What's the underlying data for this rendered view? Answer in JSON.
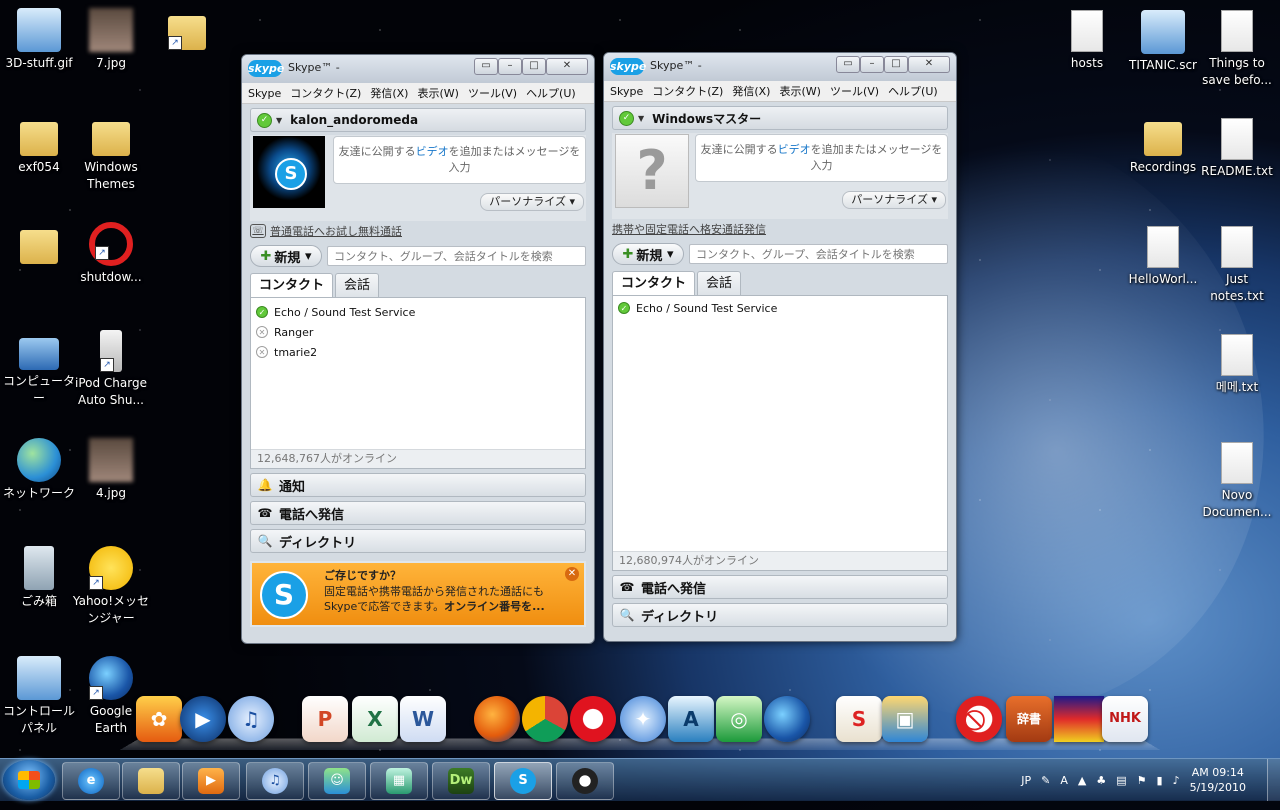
{
  "desktop": {
    "icons_left": [
      {
        "label": "3D-stuff.gif",
        "icon": "image-file-icon"
      },
      {
        "label": "7.jpg",
        "icon": "image-file-icon"
      },
      {
        "label": "",
        "icon": "folder-shortcut-icon"
      },
      {
        "label": "exf054",
        "icon": "folder-icon"
      },
      {
        "label": "Windows Themes",
        "icon": "folder-icon"
      },
      {
        "label": "",
        "icon": "user-folder-icon"
      },
      {
        "label": "shutdow...",
        "icon": "shutdown-shortcut-icon"
      },
      {
        "label": "コンピューター",
        "icon": "computer-icon"
      },
      {
        "label": "iPod Charge Auto Shu...",
        "icon": "ipod-icon"
      },
      {
        "label": "ネットワーク",
        "icon": "network-icon"
      },
      {
        "label": "4.jpg",
        "icon": "image-file-icon"
      },
      {
        "label": "ごみ箱",
        "icon": "recycle-bin-icon"
      },
      {
        "label": "Yahoo!メッセンジャー",
        "icon": "yahoo-messenger-icon"
      },
      {
        "label": "コントロール パネル",
        "icon": "control-panel-icon"
      },
      {
        "label": "Google Earth",
        "icon": "google-earth-icon"
      }
    ],
    "icons_right": [
      {
        "label": "hosts",
        "icon": "file-icon"
      },
      {
        "label": "TITANIC.scr",
        "icon": "screensaver-icon"
      },
      {
        "label": "Things to save befo...",
        "icon": "text-file-icon"
      },
      {
        "label": "Recordings",
        "icon": "folder-icon"
      },
      {
        "label": "README.txt",
        "icon": "text-file-icon"
      },
      {
        "label": "HelloWorl...",
        "icon": "file-icon"
      },
      {
        "label": "Just notes.txt",
        "icon": "text-file-icon"
      },
      {
        "label": "메메.txt",
        "icon": "text-file-icon"
      },
      {
        "label": "Novo Documen...",
        "icon": "text-file-icon"
      }
    ]
  },
  "skype_left": {
    "title": "Skype™ - ",
    "menu": [
      "Skype",
      "コンタクト(Z)",
      "発信(X)",
      "表示(W)",
      "ツール(V)",
      "ヘルプ(U)"
    ],
    "username": "kalon_andoromeda",
    "mood_before": "友達に公開する",
    "mood_link": "ビデオ",
    "mood_after": "を追加またはメッセージを入力",
    "personalize": "パーソナライズ",
    "phone_link": "普通電話へお試し無料通話",
    "new_button": "新規",
    "search_placeholder": "コンタクト、グループ、会話タイトルを検索",
    "tab_contacts": "コンタクト",
    "tab_conversations": "会話",
    "contacts": [
      {
        "name": "Echo / Sound Test Service",
        "status": "online"
      },
      {
        "name": "Ranger",
        "status": "offline"
      },
      {
        "name": "tmarie2",
        "status": "offline"
      }
    ],
    "online_count": "12,648,767人がオンライン",
    "sections": [
      "通知",
      "電話へ発信",
      "ディレクトリ"
    ],
    "promo_title": "ご存じですか？",
    "promo_text": "固定電話や携帯電話から発信された通話にもSkypeで応答できます。",
    "promo_link": "オンライン番号を..."
  },
  "skype_right": {
    "title": "Skype™ - ",
    "menu": [
      "Skype",
      "コンタクト(Z)",
      "発信(X)",
      "表示(W)",
      "ツール(V)",
      "ヘルプ(U)"
    ],
    "username": "Windowsマスター",
    "mood_before": "友達に公開する",
    "mood_link": "ビデオ",
    "mood_after": "を追加またはメッセージを入力",
    "personalize": "パーソナライズ",
    "phone_link": "携帯や固定電話へ格安通話発信",
    "new_button": "新規",
    "search_placeholder": "コンタクト、グループ、会話タイトルを検索",
    "tab_contacts": "コンタクト",
    "tab_conversations": "会話",
    "contacts": [
      {
        "name": "Echo / Sound Test Service",
        "status": "online"
      }
    ],
    "online_count": "12,680,974人がオンライン",
    "sections": [
      "電話へ発信",
      "ディレクトリ"
    ]
  },
  "dock": {
    "labels": {
      "dreamweaver": "Dw",
      "dictionary": "辞書",
      "nhk": "NHK"
    }
  },
  "taskbar": {
    "dw_label": "Dw",
    "lang": "JP",
    "ime": "A",
    "time": "AM 09:14",
    "date": "5/19/2010"
  }
}
